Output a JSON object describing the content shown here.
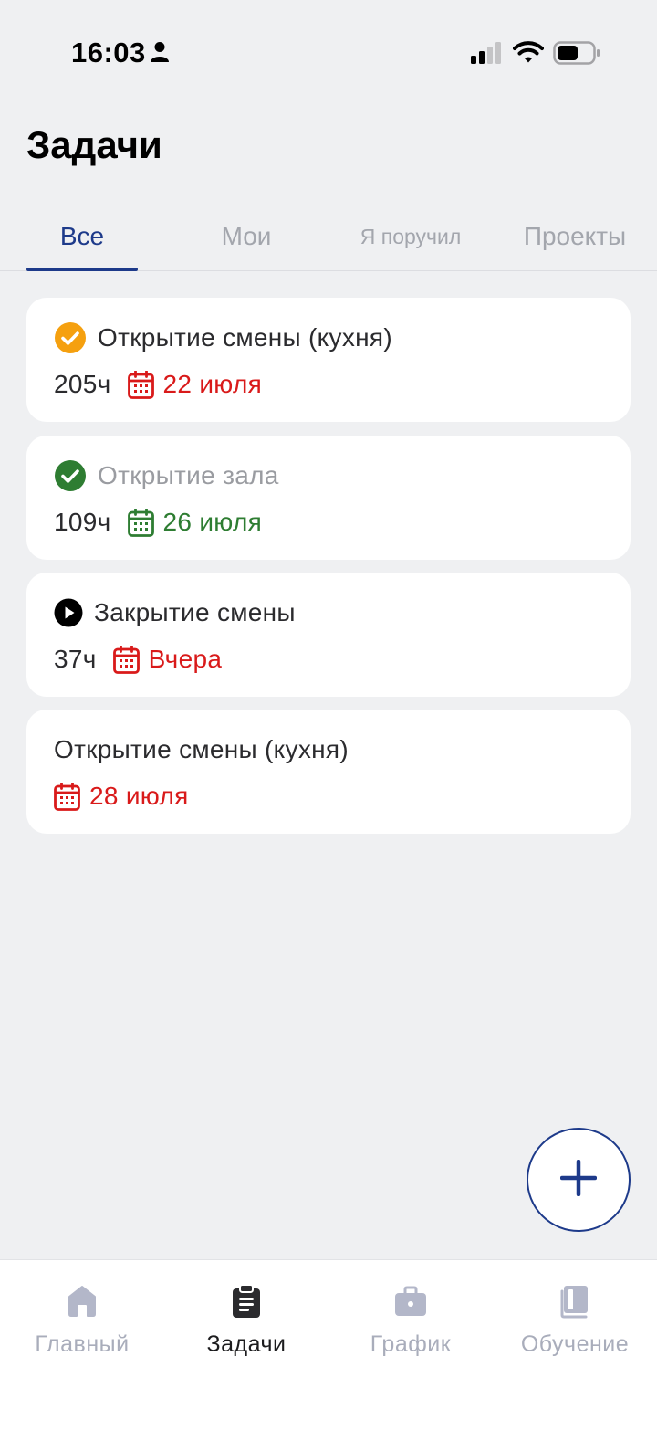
{
  "status_bar": {
    "time": "16:03",
    "icons": [
      "person-icon",
      "cellular-signal-icon",
      "wifi-icon",
      "battery-icon"
    ]
  },
  "header": {
    "title": "Задачи"
  },
  "tabs": [
    {
      "label": "Все",
      "active": true
    },
    {
      "label": "Мои",
      "active": false
    },
    {
      "label": "Я поручил",
      "active": false
    },
    {
      "label": "Проекты",
      "active": false
    }
  ],
  "tasks": [
    {
      "title": "Открытие смены (кухня)",
      "status_icon": "check-circle-icon",
      "status_color": "#f5a00f",
      "hours": "205ч",
      "date": "22 июля",
      "date_color": "#d91a1a"
    },
    {
      "title": "Открытие зала",
      "status_icon": "check-circle-icon",
      "status_color": "#2e7d32",
      "hours": "109ч",
      "date": "26 июля",
      "date_color": "#2e7d32"
    },
    {
      "title": "Закрытие смены",
      "status_icon": "play-circle-icon",
      "status_color": "#000000",
      "hours": "37ч",
      "date": "Вчера",
      "date_color": "#d91a1a"
    },
    {
      "title": "Открытие смены (кухня)",
      "status_icon": "",
      "hours": "",
      "date": "28 июля",
      "date_color": "#d91a1a"
    }
  ],
  "fab": {
    "icon": "plus-icon"
  },
  "bottom_nav": [
    {
      "label": "Главный",
      "icon": "home-icon",
      "active": false
    },
    {
      "label": "Задачи",
      "icon": "clipboard-icon",
      "active": true
    },
    {
      "label": "График",
      "icon": "briefcase-icon",
      "active": false
    },
    {
      "label": "Обучение",
      "icon": "book-icon",
      "active": false
    }
  ],
  "colors": {
    "accent": "#1d3a8a",
    "background": "#eff0f2",
    "overdue_red": "#d91a1a",
    "done_green": "#2e7d32",
    "in_review_orange": "#f5a00f",
    "inactive_gray": "#a9adbb"
  }
}
